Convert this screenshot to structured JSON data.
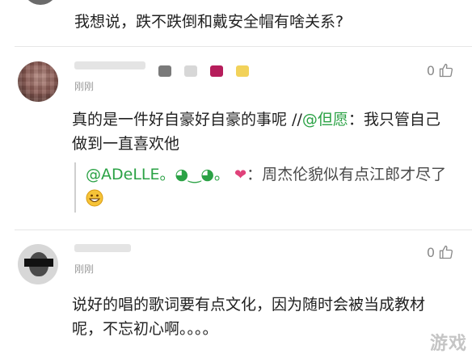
{
  "top": {
    "text": "我想说，跌不跌倒和戴安全帽有啥关系?"
  },
  "comments": [
    {
      "time": "刚刚",
      "likes": "0",
      "body_main": "真的是一件好自豪好自豪的事呢 //",
      "body_mention": "@但愿",
      "body_rest": "：我只管自己做到一直喜欢他",
      "reply_mention": "@ADeLLE。",
      "reply_kaomoji": "◕‿◕。",
      "reply_heart": "❤",
      "reply_text": "：周杰伦貌似有点江郎才尽了",
      "reply_emoji": "grinning-face"
    },
    {
      "time": "刚刚",
      "likes": "0",
      "body": "说好的唱的歌词要有点文化，因为随时会被当成教材呢，不忘初心啊。。。。"
    }
  ],
  "watermark": {
    "text": "游戏"
  },
  "colors": {
    "mention": "#2ba245",
    "time": "#9a9a9a",
    "divider": "#e6e6e6",
    "heart": "#e0427a"
  }
}
